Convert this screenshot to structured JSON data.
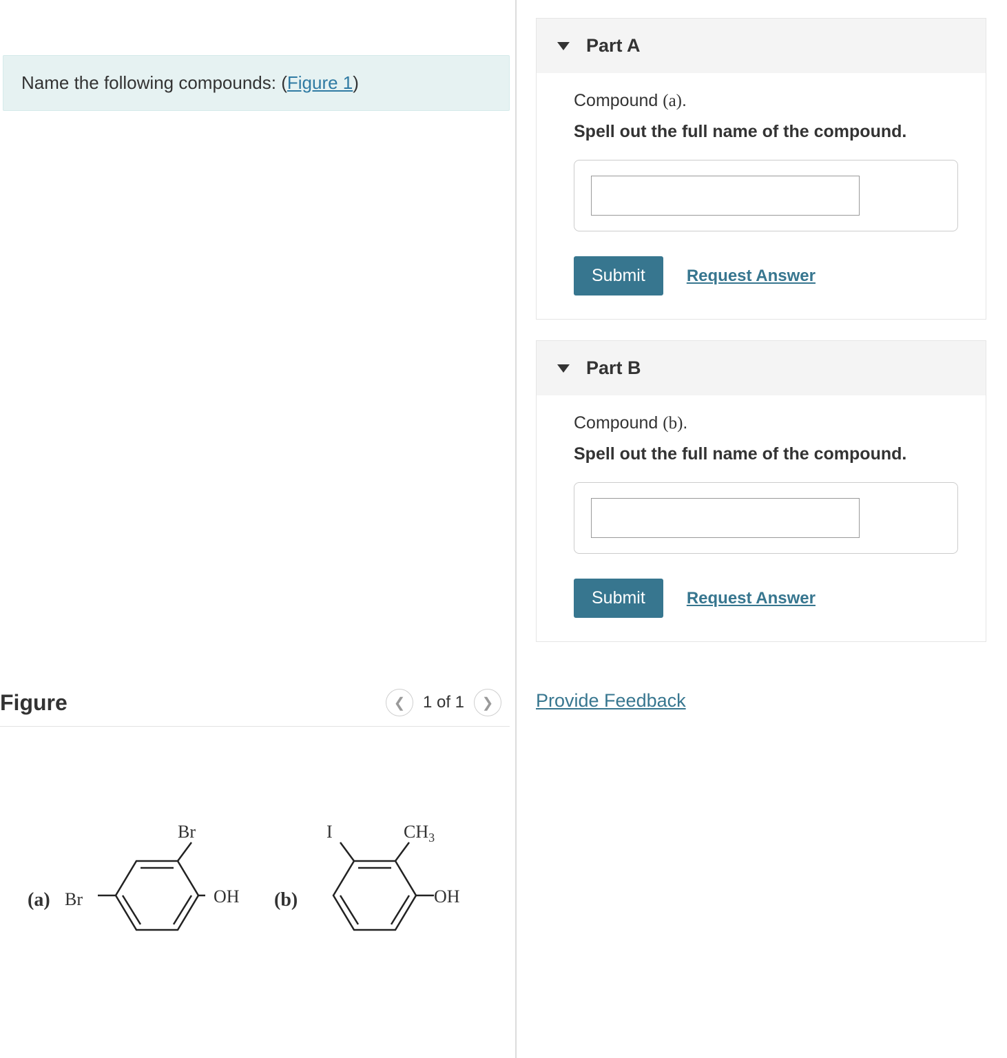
{
  "prompt": {
    "text_before": "Name the following compounds: (",
    "figure_link": "Figure 1",
    "text_after": ")"
  },
  "figure": {
    "title": "Figure",
    "pager": "1 of 1",
    "mol_a": {
      "label": "(a)",
      "sub_left": "Br",
      "sub_top": "Br",
      "sub_right": "OH"
    },
    "mol_b": {
      "label": "(b)",
      "sub_top_left": "I",
      "sub_top_right": "CH",
      "sub_top_right_subscript": "3",
      "sub_right": "OH"
    }
  },
  "parts": [
    {
      "header": "Part A",
      "compound_line_prefix": "Compound ",
      "compound_letter": "(a)",
      "compound_line_suffix": ".",
      "instruction": "Spell out the full name of the compound.",
      "submit": "Submit",
      "request_answer": "Request Answer"
    },
    {
      "header": "Part B",
      "compound_line_prefix": "Compound ",
      "compound_letter": "(b)",
      "compound_line_suffix": ".",
      "instruction": "Spell out the full name of the compound.",
      "submit": "Submit",
      "request_answer": "Request Answer"
    }
  ],
  "feedback": "Provide Feedback"
}
